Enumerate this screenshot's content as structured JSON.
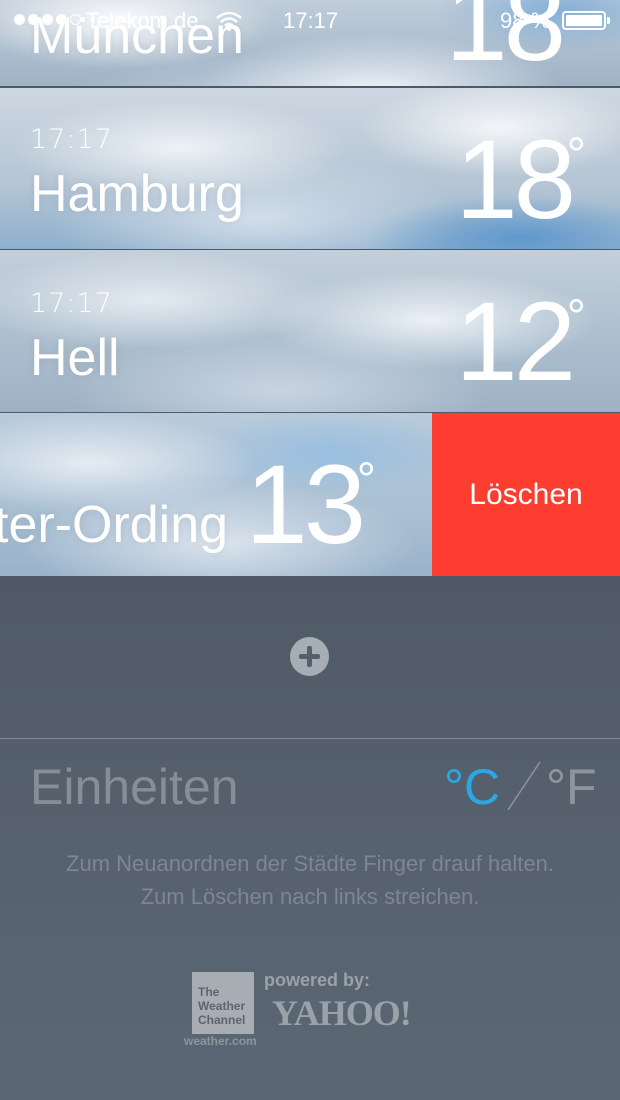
{
  "status_bar": {
    "carrier": "Telekom.de",
    "time": "17:17",
    "battery": "98 %"
  },
  "cities": [
    {
      "time": "",
      "name": "München",
      "temp": "18",
      "deg": "°"
    },
    {
      "time": "17:17",
      "name": "Hamburg",
      "temp": "18",
      "deg": "°"
    },
    {
      "time": "17:17",
      "name": "Hell",
      "temp": "12",
      "deg": "°"
    },
    {
      "time": "",
      "name": "ter-Ording",
      "temp": "13",
      "deg": "°"
    }
  ],
  "delete_label": "Löschen",
  "units": {
    "label": "Einheiten",
    "celsius": "°C",
    "fahrenheit": "°F",
    "active": "C",
    "active_color": "#2aa7e5"
  },
  "hints": {
    "line1": "Zum Neuanordnen der Städte Finger drauf halten.",
    "line2": "Zum Löschen nach links streichen."
  },
  "credits": {
    "twc_line1": "The",
    "twc_line2": "Weather",
    "twc_line3": "Channel",
    "twc_url": "weather.com",
    "powered_by": "powered by:",
    "yahoo": "YAHOO!"
  },
  "icons": {
    "add": "add-city-icon",
    "wifi": "wifi-icon",
    "battery": "battery-icon"
  }
}
